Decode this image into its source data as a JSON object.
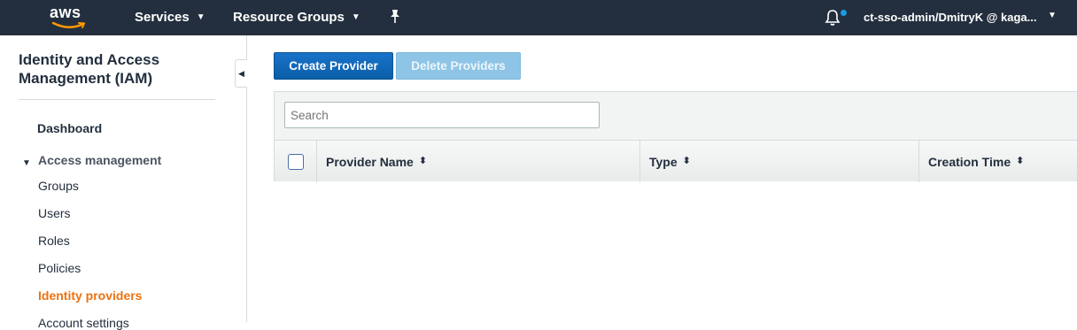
{
  "topbar": {
    "logo_text": "aws",
    "services_label": "Services",
    "resource_groups_label": "Resource Groups",
    "account_label": "ct-sso-admin/DmitryK @ kaga...",
    "accent_color": "#ff9900",
    "notification_dot_color": "#1a9ce0"
  },
  "sidebar": {
    "title": "Identity and Access Management (IAM)",
    "dashboard": "Dashboard",
    "section_label": "Access management",
    "items": [
      {
        "label": "Groups"
      },
      {
        "label": "Users"
      },
      {
        "label": "Roles"
      },
      {
        "label": "Policies"
      },
      {
        "label": "Identity providers"
      },
      {
        "label": "Account settings"
      }
    ],
    "active_color": "#ec7211"
  },
  "main": {
    "create_button": "Create Provider",
    "delete_button": "Delete Providers",
    "search_placeholder": "Search",
    "columns": [
      {
        "label": "Provider Name"
      },
      {
        "label": "Type"
      },
      {
        "label": "Creation Time"
      }
    ]
  }
}
